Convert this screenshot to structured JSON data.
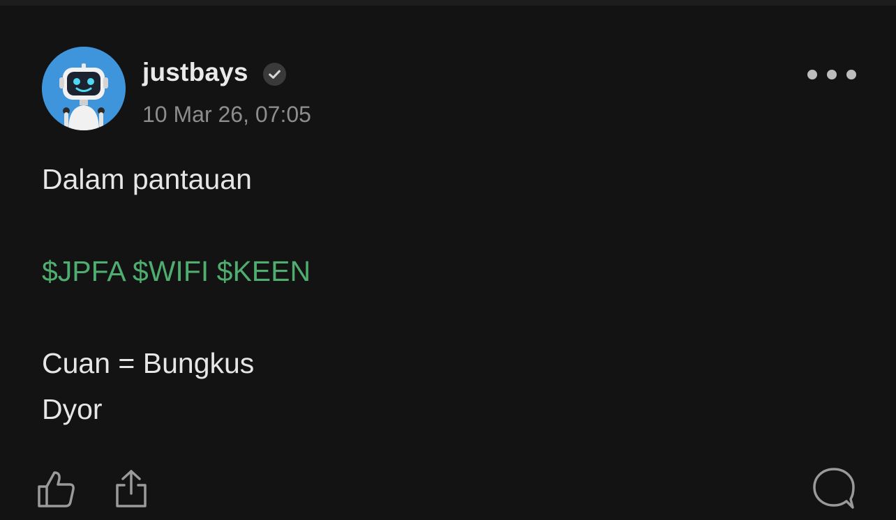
{
  "post": {
    "author": {
      "username": "justbays",
      "avatar_icon": "robot-avatar",
      "avatar_color": "#3f95dc",
      "verified": true,
      "verified_icon": "verified-check-icon"
    },
    "timestamp": "10 Mar 26, 07:05",
    "menu_icon": "more-options-icon",
    "body": {
      "line1": "Dalam pantauan",
      "tickers": [
        "$JPFA",
        "$WIFI",
        "$KEEN"
      ],
      "line3": "Cuan = Bungkus",
      "line4": "Dyor"
    },
    "actions": {
      "like_icon": "thumbs-up-icon",
      "share_icon": "share-icon",
      "comment_icon": "comment-bubble-icon"
    }
  },
  "colors": {
    "background": "#131313",
    "ticker": "#4fae6f",
    "text": "#e6e6e6",
    "muted": "#8d8d8d"
  }
}
